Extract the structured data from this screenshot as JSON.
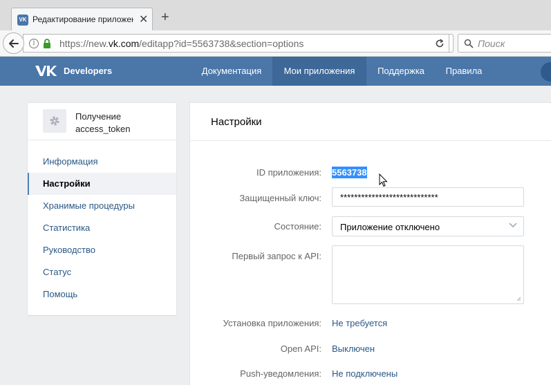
{
  "browser": {
    "tab_title": "Редактирование приложения",
    "url_prefix": "https://new.",
    "url_domain": "vk.com",
    "url_path": "/editapp?id=5563738&section=options",
    "search_placeholder": "Поиск"
  },
  "header": {
    "brand": "Developers",
    "nav": [
      "Документация",
      "Мои приложения",
      "Поддержка",
      "Правила"
    ],
    "active_nav": "Мои приложения",
    "colors": {
      "bar": "#4a76a8",
      "active": "#3d6898"
    }
  },
  "sidebar": {
    "app_name": "Получение access_token",
    "items": [
      "Информация",
      "Настройки",
      "Хранимые процедуры",
      "Статистика",
      "Руководство",
      "Статус",
      "Помощь"
    ],
    "active_item": "Настройки"
  },
  "settings": {
    "title": "Настройки",
    "id_label": "ID приложения:",
    "id_value": "5563738",
    "key_label": "Защищенный ключ:",
    "key_value": "****************************",
    "state_label": "Состояние:",
    "state_value": "Приложение отключено",
    "first_request_label": "Первый запрос к API:",
    "first_request_value": "",
    "install_label": "Установка приложения:",
    "install_value": "Не требуется",
    "openapi_label": "Open API:",
    "openapi_value": "Выключен",
    "push_label": "Push-уведомления:",
    "push_value": "Не подключены"
  }
}
